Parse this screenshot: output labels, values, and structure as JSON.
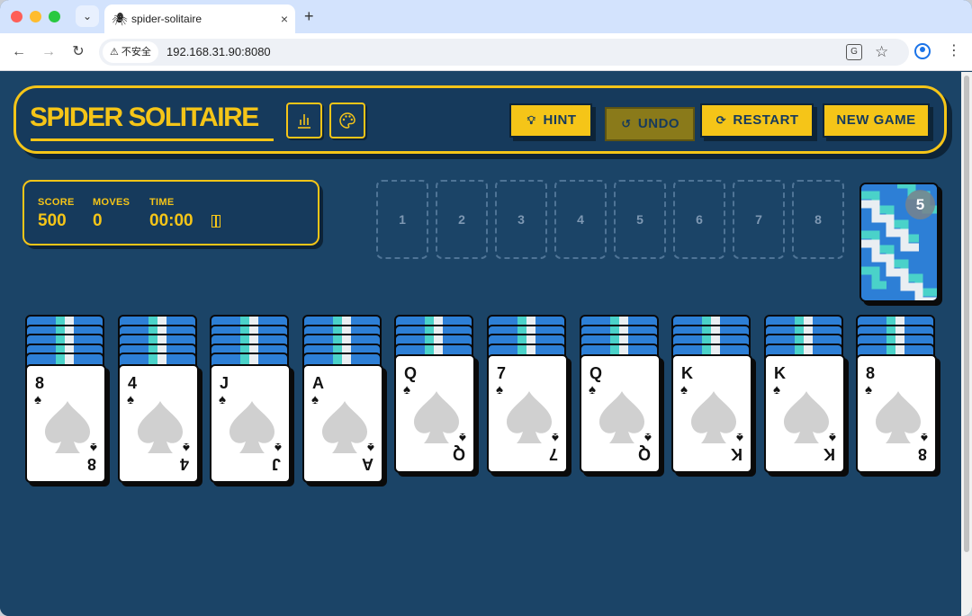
{
  "browser": {
    "tab_menu_glyph": "⌄",
    "tab": {
      "favicon": "🕷",
      "title": "spider-solitaire",
      "close": "×"
    },
    "new_tab": "+",
    "nav": {
      "back": "←",
      "forward": "→",
      "reload": "↻"
    },
    "security_label": "不安全",
    "url": "192.168.31.90:8080",
    "translate_glyph": "G",
    "star_glyph": "☆",
    "menu_glyph": "⋮"
  },
  "header": {
    "title": "SPIDER SOLITAIRE",
    "buttons": {
      "hint": "HINT",
      "undo": "UNDO",
      "restart": "RESTART",
      "new_game": "NEW GAME"
    }
  },
  "stats": {
    "score_label": "SCORE",
    "score": "500",
    "moves_label": "MOVES",
    "moves": "0",
    "time_label": "TIME",
    "time": "00:00"
  },
  "foundations": [
    "1",
    "2",
    "3",
    "4",
    "5",
    "6",
    "7",
    "8"
  ],
  "stock": {
    "deals_remaining": "5"
  },
  "tableau": [
    {
      "face_down": 5,
      "top": {
        "rank": "8",
        "suit": "♠"
      }
    },
    {
      "face_down": 5,
      "top": {
        "rank": "4",
        "suit": "♠"
      }
    },
    {
      "face_down": 5,
      "top": {
        "rank": "J",
        "suit": "♠"
      }
    },
    {
      "face_down": 5,
      "top": {
        "rank": "A",
        "suit": "♠"
      }
    },
    {
      "face_down": 4,
      "top": {
        "rank": "Q",
        "suit": "♠"
      }
    },
    {
      "face_down": 4,
      "top": {
        "rank": "7",
        "suit": "♠"
      }
    },
    {
      "face_down": 4,
      "top": {
        "rank": "Q",
        "suit": "♠"
      }
    },
    {
      "face_down": 4,
      "top": {
        "rank": "K",
        "suit": "♠"
      }
    },
    {
      "face_down": 4,
      "top": {
        "rank": "K",
        "suit": "♠"
      }
    },
    {
      "face_down": 4,
      "top": {
        "rank": "8",
        "suit": "♠"
      }
    }
  ],
  "colors": {
    "accent": "#f5c518",
    "panel": "#163a5c",
    "page_bg": "#1b4467",
    "card_back_blue": "#2d7fd6",
    "card_back_teal": "#4ad2c9",
    "suit_watermark": "#d0d0d0"
  }
}
